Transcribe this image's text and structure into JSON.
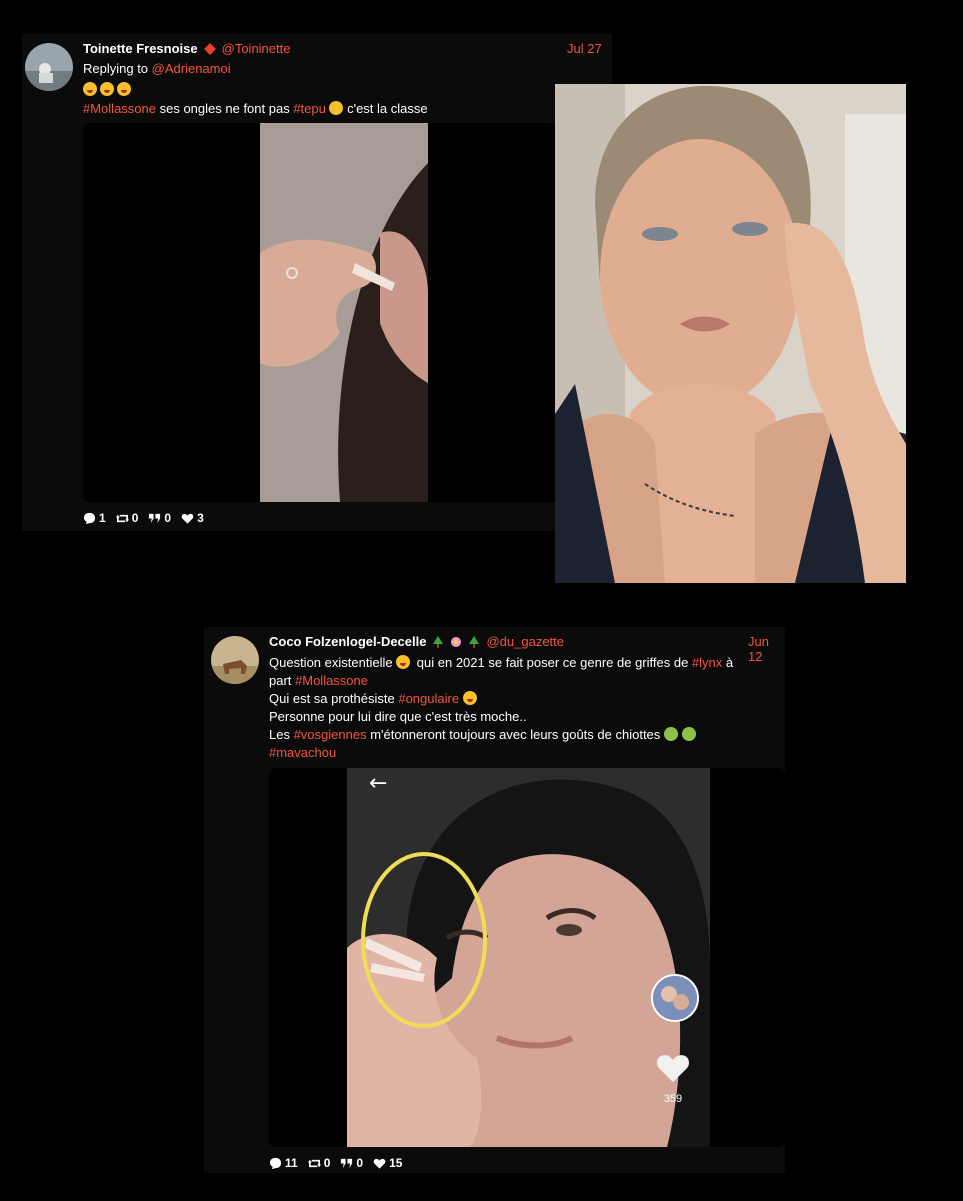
{
  "tweet1": {
    "name": "Toinette Fresnoise",
    "handle": "@Toininette",
    "date": "Jul 27",
    "reply_prefix": "Replying to",
    "reply_handle": "@Adrienamoi",
    "line2_hashtag1": "#Mollassone",
    "line2_text1": " ses ongles ne font pas ",
    "line2_hashtag2": "#tepu",
    "line2_text2": " c'est la classe",
    "stats": {
      "replies": "1",
      "retweets": "0",
      "quotes": "0",
      "likes": "3"
    }
  },
  "tweet2": {
    "name": "Coco Folzenlogel-Decelle",
    "handle": "@du_gazette",
    "date": "Jun 12",
    "l1_a": "Question existentielle ",
    "l1_b": " qui en 2021 se fait poser ce genre de griffes de ",
    "l1_tag": "#lynx",
    "l1_c": " à",
    "l2_a": "part ",
    "l2_tag": "#Mollassone",
    "l3_a": "Qui est sa prothésiste ",
    "l3_tag": "#ongulaire",
    "l4": "Personne pour lui dire que c'est très moche..",
    "l5_a": "Les ",
    "l5_tag": "#vosgiennes",
    "l5_b": " m'étonneront toujours avec leurs goûts de chiottes ",
    "l6_tag": "#mavachou",
    "video_like_count": "359",
    "stats": {
      "replies": "11",
      "retweets": "0",
      "quotes": "0",
      "likes": "15"
    }
  },
  "colors": {
    "accent": "#f3553c",
    "background": "#000000",
    "card": "#0b0b0b",
    "highlight": "#f0dd55"
  }
}
